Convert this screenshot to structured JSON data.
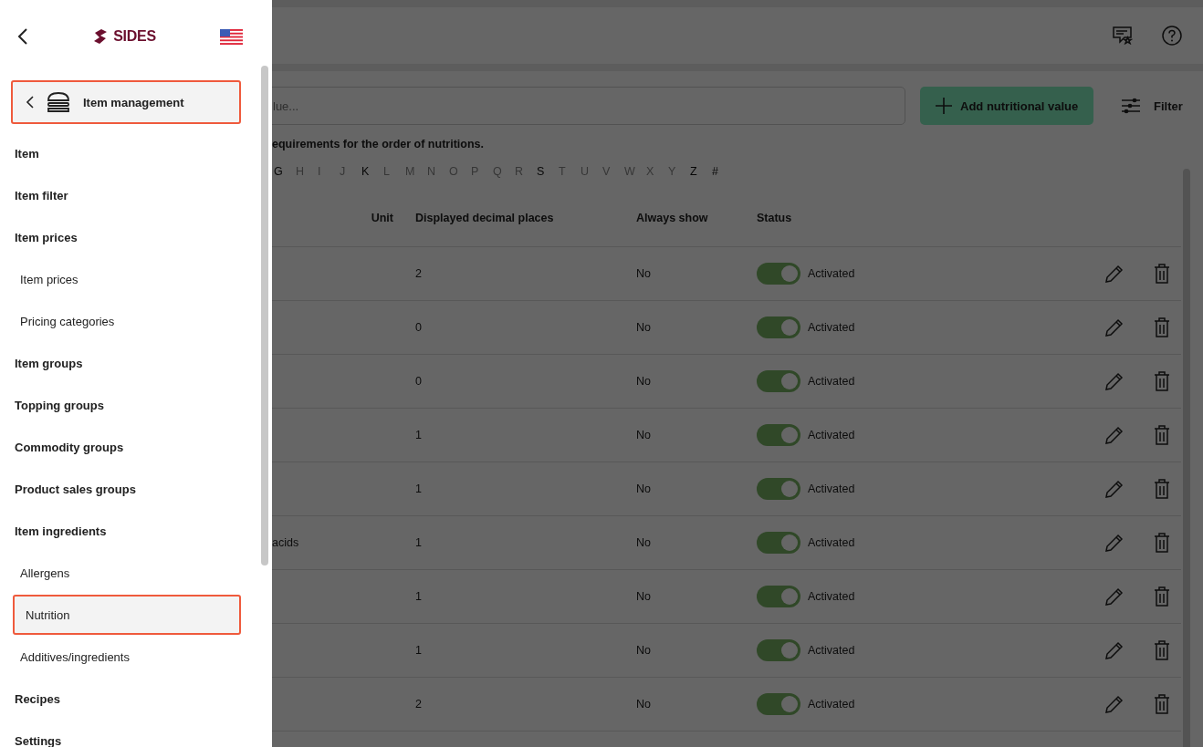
{
  "sidebar": {
    "logo": "SIDES",
    "section": {
      "label": "Item management",
      "selected": true
    },
    "items": [
      {
        "label": "Item",
        "kind": "group",
        "selected": false
      },
      {
        "label": "Item filter",
        "kind": "group",
        "selected": false
      },
      {
        "label": "Item prices",
        "kind": "group",
        "selected": false
      },
      {
        "label": "Item prices",
        "kind": "sub",
        "selected": false
      },
      {
        "label": "Pricing categories",
        "kind": "sub",
        "selected": false
      },
      {
        "label": "Item groups",
        "kind": "group",
        "selected": false
      },
      {
        "label": "Topping groups",
        "kind": "group",
        "selected": false
      },
      {
        "label": "Commodity groups",
        "kind": "group",
        "selected": false
      },
      {
        "label": "Product sales groups",
        "kind": "group",
        "selected": false
      },
      {
        "label": "Item ingredients",
        "kind": "group",
        "selected": false
      },
      {
        "label": "Allergens",
        "kind": "sub",
        "selected": false
      },
      {
        "label": "Nutrition",
        "kind": "sub",
        "selected": true
      },
      {
        "label": "Additives/ingredients",
        "kind": "sub",
        "selected": false
      },
      {
        "label": "Recipes",
        "kind": "group",
        "selected": false
      },
      {
        "label": "Settings",
        "kind": "group",
        "selected": false
      }
    ]
  },
  "search": {
    "placeholder": "lue..."
  },
  "add_button": "Add nutritional value",
  "filter_button": "Filter",
  "note": "equirements for the order of nutritions.",
  "letters": [
    {
      "label": "G",
      "disabled": false
    },
    {
      "label": "H",
      "disabled": true
    },
    {
      "label": "I",
      "disabled": true
    },
    {
      "label": "J",
      "disabled": true
    },
    {
      "label": "K",
      "disabled": false
    },
    {
      "label": "L",
      "disabled": true
    },
    {
      "label": "M",
      "disabled": true
    },
    {
      "label": "N",
      "disabled": true
    },
    {
      "label": "O",
      "disabled": true
    },
    {
      "label": "P",
      "disabled": true
    },
    {
      "label": "Q",
      "disabled": true
    },
    {
      "label": "R",
      "disabled": true
    },
    {
      "label": "S",
      "disabled": false
    },
    {
      "label": "T",
      "disabled": true
    },
    {
      "label": "U",
      "disabled": true
    },
    {
      "label": "V",
      "disabled": true
    },
    {
      "label": "W",
      "disabled": true
    },
    {
      "label": "X",
      "disabled": true
    },
    {
      "label": "Y",
      "disabled": true
    },
    {
      "label": "Z",
      "disabled": false
    },
    {
      "label": "#",
      "disabled": false
    }
  ],
  "table": {
    "columns": [
      "Unit",
      "Displayed decimal places",
      "Always show",
      "Status"
    ],
    "rows": [
      {
        "decimals": "2",
        "always_show": "No",
        "on": true,
        "status": "Activated"
      },
      {
        "decimals": "0",
        "always_show": "No",
        "on": true,
        "status": "Activated"
      },
      {
        "decimals": "0",
        "always_show": "No",
        "on": true,
        "status": "Activated"
      },
      {
        "decimals": "1",
        "always_show": "No",
        "on": true,
        "status": "Activated"
      },
      {
        "decimals": "1",
        "always_show": "No",
        "on": true,
        "status": "Activated"
      },
      {
        "name": "acids",
        "decimals": "1",
        "always_show": "No",
        "on": true,
        "status": "Activated"
      },
      {
        "decimals": "1",
        "always_show": "No",
        "on": true,
        "status": "Activated"
      },
      {
        "decimals": "1",
        "always_show": "No",
        "on": true,
        "status": "Activated"
      },
      {
        "decimals": "2",
        "always_show": "No",
        "on": true,
        "status": "Activated"
      }
    ]
  }
}
